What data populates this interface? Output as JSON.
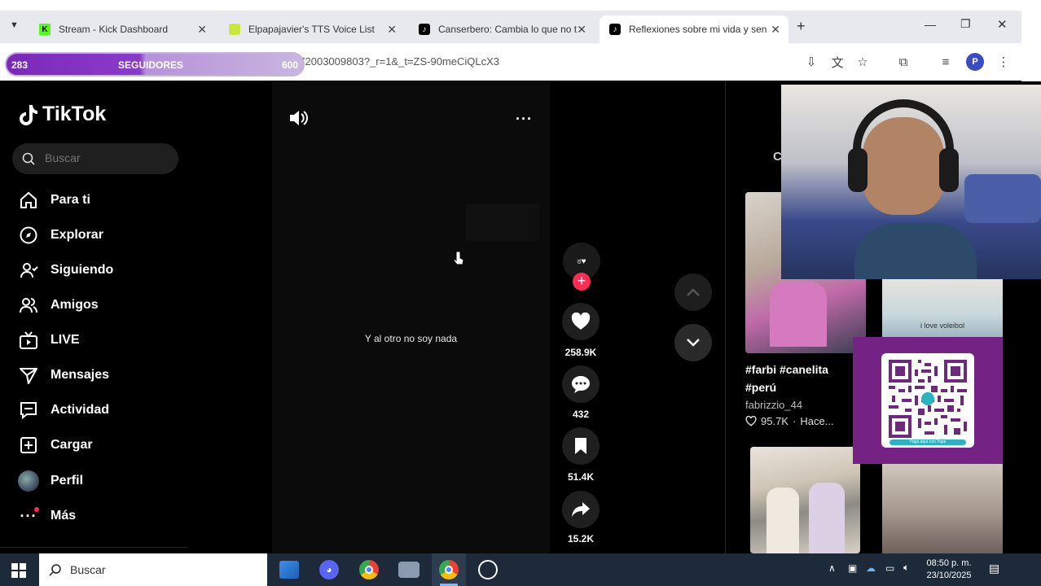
{
  "browser": {
    "tabs": [
      {
        "title": "Stream - Kick Dashboard",
        "favicon": "K",
        "color": "#53fc18"
      },
      {
        "title": "Elpapajavier's TTS Voice List",
        "favicon": "",
        "color": "#c8e63c"
      },
      {
        "title": "Canserbero: Cambia lo que no t",
        "favicon": "tiktok",
        "color": "#000"
      },
      {
        "title": "Reflexiones sobre mi vida y sen",
        "favicon": "tiktok",
        "color": "#000"
      }
    ],
    "url": "...c03j07/video/7560536172003009803?_r=1&_t=ZS-90meCiQLcX3"
  },
  "overlay": {
    "followers_current": "283",
    "followers_label": "SEGUIDORES",
    "followers_goal": "600",
    "followers_progress": 0.47
  },
  "tiktok": {
    "brand": "TikTok",
    "search_placeholder": "Buscar",
    "nav": [
      {
        "label": "Para ti",
        "icon": "home-icon"
      },
      {
        "label": "Explorar",
        "icon": "compass-icon"
      },
      {
        "label": "Siguiendo",
        "icon": "following-icon"
      },
      {
        "label": "Amigos",
        "icon": "friends-icon"
      },
      {
        "label": "LIVE",
        "icon": "live-icon"
      },
      {
        "label": "Mensajes",
        "icon": "messages-icon"
      },
      {
        "label": "Actividad",
        "icon": "activity-icon"
      },
      {
        "label": "Cargar",
        "icon": "upload-icon"
      },
      {
        "label": "Perfil",
        "icon": "profile-avatar"
      },
      {
        "label": "Más",
        "icon": "more-icon"
      }
    ]
  },
  "video": {
    "caption": "Y al otro no soy nada",
    "likes": "258.9K",
    "comments": "432",
    "saves": "51.4K",
    "shares": "15.2K"
  },
  "right_panel": {
    "tab_letter": "C",
    "card": {
      "title": "#farbi #canelita #perú",
      "author": "fabrizzio_44",
      "likes": "95.7K",
      "time": "Hace..."
    },
    "thumb_text": "i love voleibol",
    "qr_caption": "Paga aquí con Yape"
  },
  "taskbar": {
    "search_placeholder": "Buscar",
    "time": "08:50 p. m.",
    "date": "23/10/2025"
  },
  "colors": {
    "tiktok_red": "#fe2c55",
    "purple": "#742284"
  }
}
